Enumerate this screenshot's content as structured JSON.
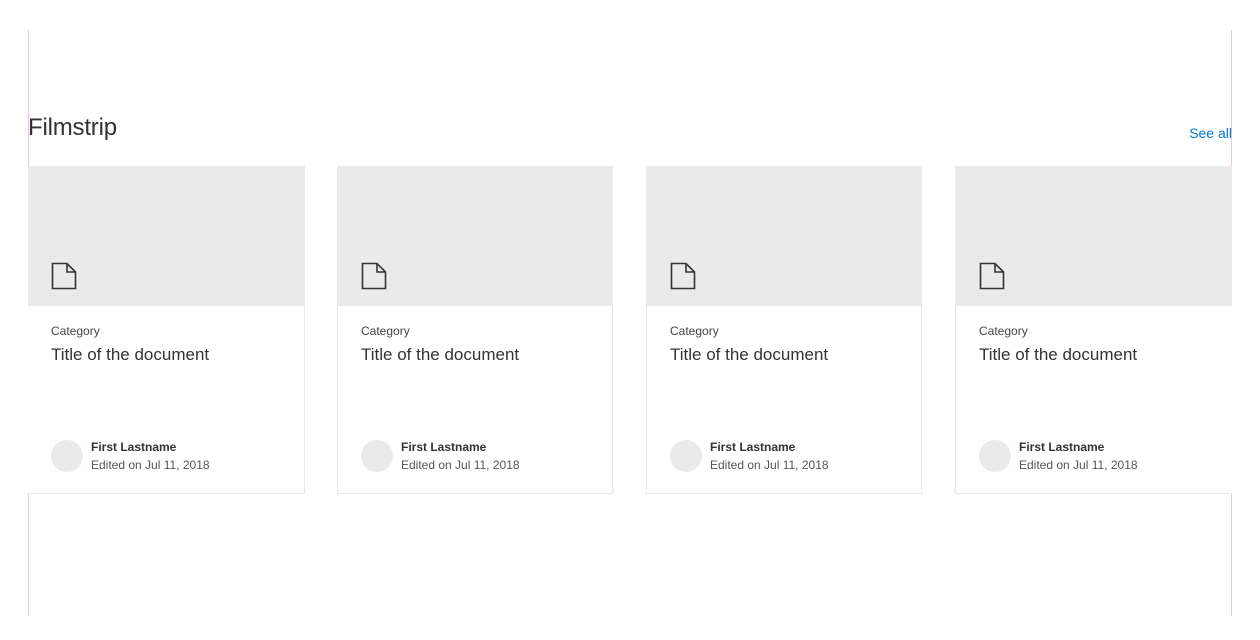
{
  "section": {
    "title": "Filmstrip",
    "see_all_label": "See all"
  },
  "cards": [
    {
      "icon": "document-icon",
      "category": "Category",
      "title": "Title of the document",
      "author": "First Lastname",
      "edited": "Edited on Jul 11, 2018"
    },
    {
      "icon": "document-icon",
      "category": "Category",
      "title": "Title of the document",
      "author": "First Lastname",
      "edited": "Edited on Jul 11, 2018"
    },
    {
      "icon": "document-icon",
      "category": "Category",
      "title": "Title of the document",
      "author": "First Lastname",
      "edited": "Edited on Jul 11, 2018"
    },
    {
      "icon": "document-icon",
      "category": "Category",
      "title": "Title of the document",
      "author": "First Lastname",
      "edited": "Edited on Jul 11, 2018"
    }
  ],
  "colors": {
    "accent": "#0078d4",
    "preview_background": "#eaeaea",
    "guide_line": "#e7c6ea"
  }
}
